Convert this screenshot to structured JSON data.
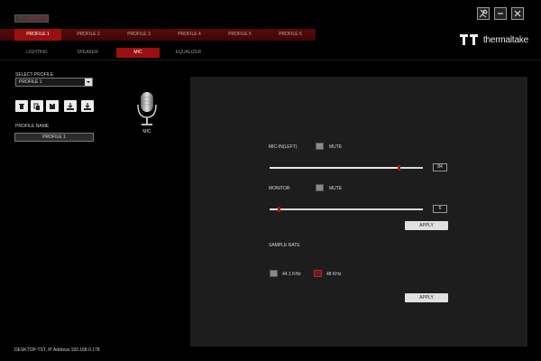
{
  "app_badge": "TT eSPORTS",
  "profile_tabs": [
    {
      "label": "PROFILE 1"
    },
    {
      "label": "PROFILE 2"
    },
    {
      "label": "PROFILE 3"
    },
    {
      "label": "PROFILE 4"
    },
    {
      "label": "PROFILE 5"
    },
    {
      "label": "PROFILE 6"
    }
  ],
  "sub_tabs": [
    {
      "label": "LIGHTING"
    },
    {
      "label": "SPEAKER"
    },
    {
      "label": "MIC"
    },
    {
      "label": "EQUALIZER"
    }
  ],
  "window_controls": {
    "tools_icon": "tools-icon",
    "minimize_icon": "minimize-icon",
    "close_icon": "close-icon"
  },
  "logo": {
    "text": "thermaltake",
    "icon": "tt-logo-icon"
  },
  "left_panel": {
    "select_profile_label": "SELECT PROFILE",
    "select_profile_value": "PROFILE 1",
    "toolbar": [
      {
        "icon": "delete-icon"
      },
      {
        "icon": "copy-icon"
      },
      {
        "icon": "paste-icon"
      },
      {
        "icon": "import-icon"
      },
      {
        "icon": "export-icon"
      }
    ],
    "profile_name_label": "PROFILE NAME",
    "profile_name_value": "PROFILE 1"
  },
  "mic": {
    "label": "MIC",
    "icon": "microphone-icon"
  },
  "status": {
    "text": "DESKTOP-TST, IP Address:192.168.0.178"
  },
  "main": {
    "mic_in": {
      "label": "MIC-IN(LEFT)",
      "mute_label": "MUTE",
      "mute_checked": false,
      "value": "84",
      "level_fraction": 0.84
    },
    "monitor": {
      "label": "MONITOR",
      "mute_label": "MUTE",
      "mute_checked": false,
      "value": "6",
      "level_fraction": 0.06
    },
    "apply_1": "APPLY",
    "sample_rate": {
      "label": "SAMPLE RATE",
      "options": [
        {
          "label": "44.1 KHz",
          "checked": false
        },
        {
          "label": "48 KHz",
          "checked": true
        }
      ]
    },
    "apply_2": "APPLY"
  },
  "colors": {
    "accent": "#9a1010",
    "thumb": "#b01010",
    "panel": "#1d1d1d"
  }
}
